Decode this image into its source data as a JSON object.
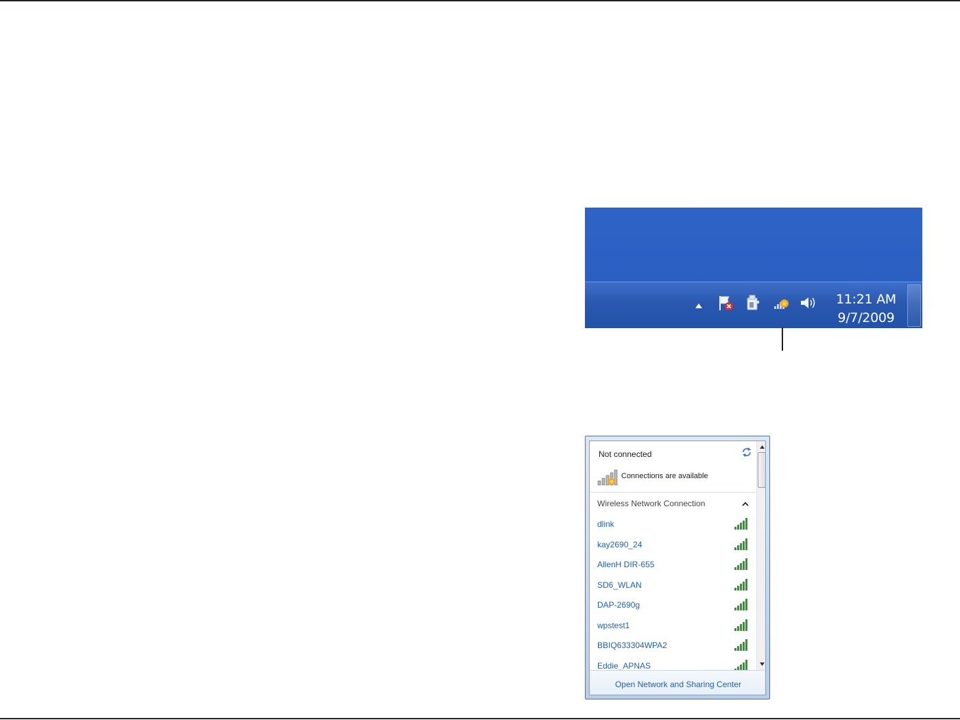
{
  "taskbar": {
    "time": "11:21 AM",
    "date": "9/7/2009",
    "icons": [
      "show-hidden-icons-arrow-icon",
      "action-center-flag-icon",
      "power-plug-icon",
      "wireless-network-icon",
      "volume-icon"
    ]
  },
  "flyout": {
    "status": "Not connected",
    "availability": "Connections are available",
    "section_title": "Wireless Network Connection",
    "networks": [
      {
        "name": "dlink"
      },
      {
        "name": "kay2690_24"
      },
      {
        "name": "AllenH DIR-655"
      },
      {
        "name": "SD6_WLAN"
      },
      {
        "name": "DAP-2690g"
      },
      {
        "name": "wpstest1"
      },
      {
        "name": "BBIQ633304WPA2"
      },
      {
        "name": "Eddie_APNAS"
      }
    ],
    "footer_link": "Open Network and Sharing Center"
  },
  "colors": {
    "taskbar_blue": "#2a58b0",
    "link_blue": "#1e5fb3",
    "signal_green": "#2e9a2e"
  }
}
